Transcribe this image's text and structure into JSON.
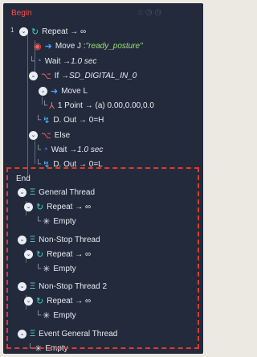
{
  "header": {
    "title": "Begin",
    "line_number": "1"
  },
  "tree": {
    "repeat_main": "Repeat → ∞",
    "movej_prefix": "Move J : ",
    "movej_target": "\"ready_posture\"",
    "wait1_prefix": "Wait → ",
    "wait1_value": "1.0 sec",
    "if_prefix": "If → ",
    "if_value": "SD_DIGITAL_IN_0",
    "movel": "Move L",
    "point": "1 Point → (a) 0.00,0.00,0.0",
    "dout1": "D. Out → 0=H",
    "else": "Else",
    "wait2_prefix": "Wait → ",
    "wait2_value": "1.0 sec",
    "dout2": "D. Out → 0=L",
    "end": "End"
  },
  "threads": [
    {
      "name": "General Thread",
      "repeat": "Repeat → ∞",
      "empty": "Empty"
    },
    {
      "name": "Non-Stop Thread",
      "repeat": "Repeat → ∞",
      "empty": "Empty"
    },
    {
      "name": "Non-Stop Thread 2",
      "repeat": "Repeat → ∞",
      "empty": "Empty"
    },
    {
      "name": "Event General Thread",
      "empty": "Empty"
    }
  ],
  "colors": {
    "move": "#4aa3ff",
    "stop": "#ff4b4b",
    "wait": "#2f8cff",
    "logic": "#ff5d6c",
    "repeat": "#3cd1c0",
    "dout": "#4fb7ff",
    "thread": "#65d0c8",
    "empty": "#e6e9ef"
  }
}
